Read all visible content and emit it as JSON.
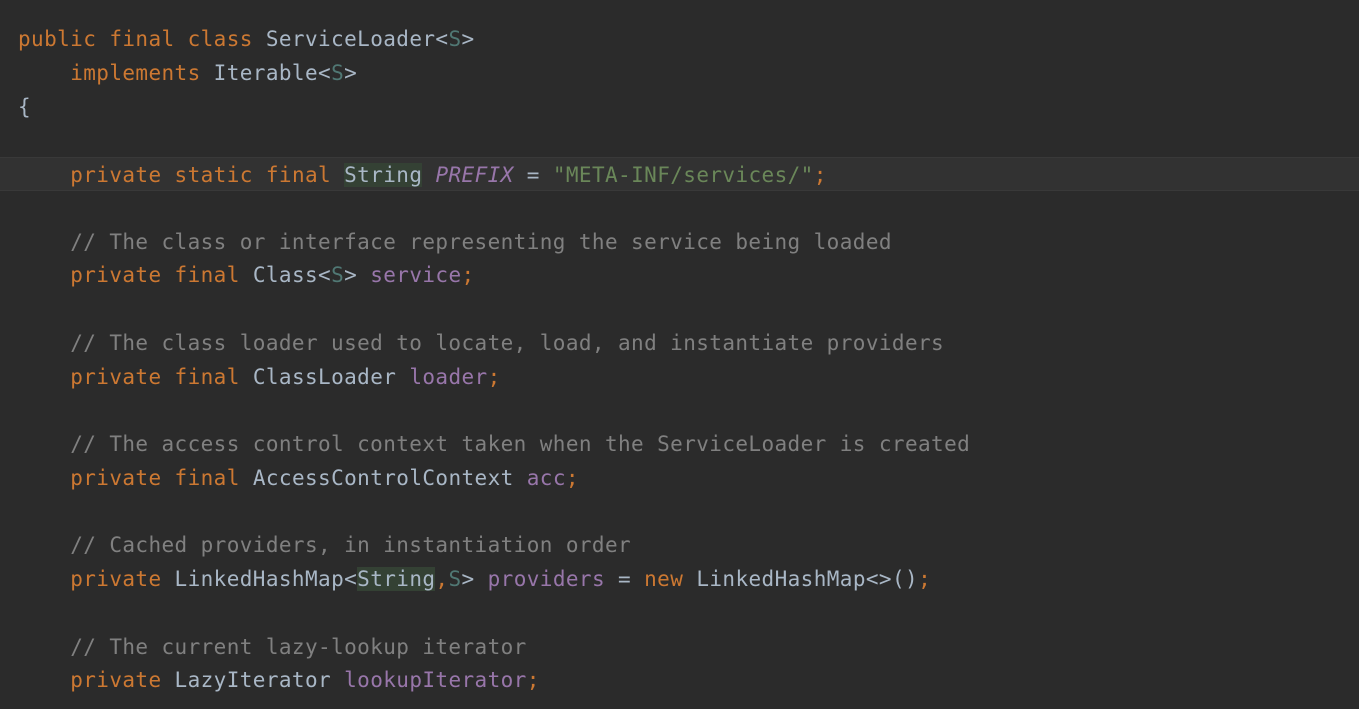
{
  "editor": {
    "colors": {
      "background": "#2b2b2b",
      "keyword": "#cc7832",
      "text": "#a9b7c6",
      "type_param": "#507874",
      "field": "#9876aa",
      "string": "#6a8759",
      "comment": "#808080",
      "usage_highlight": "#344134"
    },
    "lines": [
      {
        "t1": "public",
        "t2": "final",
        "t3": "class",
        "t4": "ServiceLoader",
        "t5": "<",
        "t6": "S",
        "t7": ">"
      },
      {
        "indent": "    ",
        "t1": "implements",
        "t2": "Iterable",
        "t3": "<",
        "t4": "S",
        "t5": ">"
      },
      {
        "t1": "{"
      },
      {},
      {
        "indent": "    ",
        "t1": "private",
        "t2": "static",
        "t3": "final",
        "t4": "String",
        "t5": "PREFIX",
        "t6": "=",
        "t7": "\"META-INF/services/\"",
        "t8": ";"
      },
      {},
      {
        "indent": "    ",
        "t1": "// The class or interface representing the service being loaded"
      },
      {
        "indent": "    ",
        "t1": "private",
        "t2": "final",
        "t3": "Class<",
        "t4": "S",
        "t5": ">",
        "t6": "service",
        "t7": ";"
      },
      {},
      {
        "indent": "    ",
        "t1": "// The class loader used to locate, load, and instantiate providers"
      },
      {
        "indent": "    ",
        "t1": "private",
        "t2": "final",
        "t3": "ClassLoader",
        "t4": "loader",
        "t5": ";"
      },
      {},
      {
        "indent": "    ",
        "t1": "// The access control context taken when the ServiceLoader is created"
      },
      {
        "indent": "    ",
        "t1": "private",
        "t2": "final",
        "t3": "AccessControlContext",
        "t4": "acc",
        "t5": ";"
      },
      {},
      {
        "indent": "    ",
        "t1": "// Cached providers, in instantiation order"
      },
      {
        "indent": "    ",
        "t1": "private",
        "t2": "LinkedHashMap<",
        "t3": "String",
        "t4": ",",
        "t5": "S",
        "t6": ">",
        "t7": "providers",
        "t8": "=",
        "t9": "new",
        "t10": "LinkedHashMap<>()",
        "t11": ";"
      },
      {},
      {
        "indent": "    ",
        "t1": "// The current lazy-lookup iterator"
      },
      {
        "indent": "    ",
        "t1": "private",
        "t2": "LazyIterator",
        "t3": "lookupIterator",
        "t4": ";"
      }
    ]
  }
}
